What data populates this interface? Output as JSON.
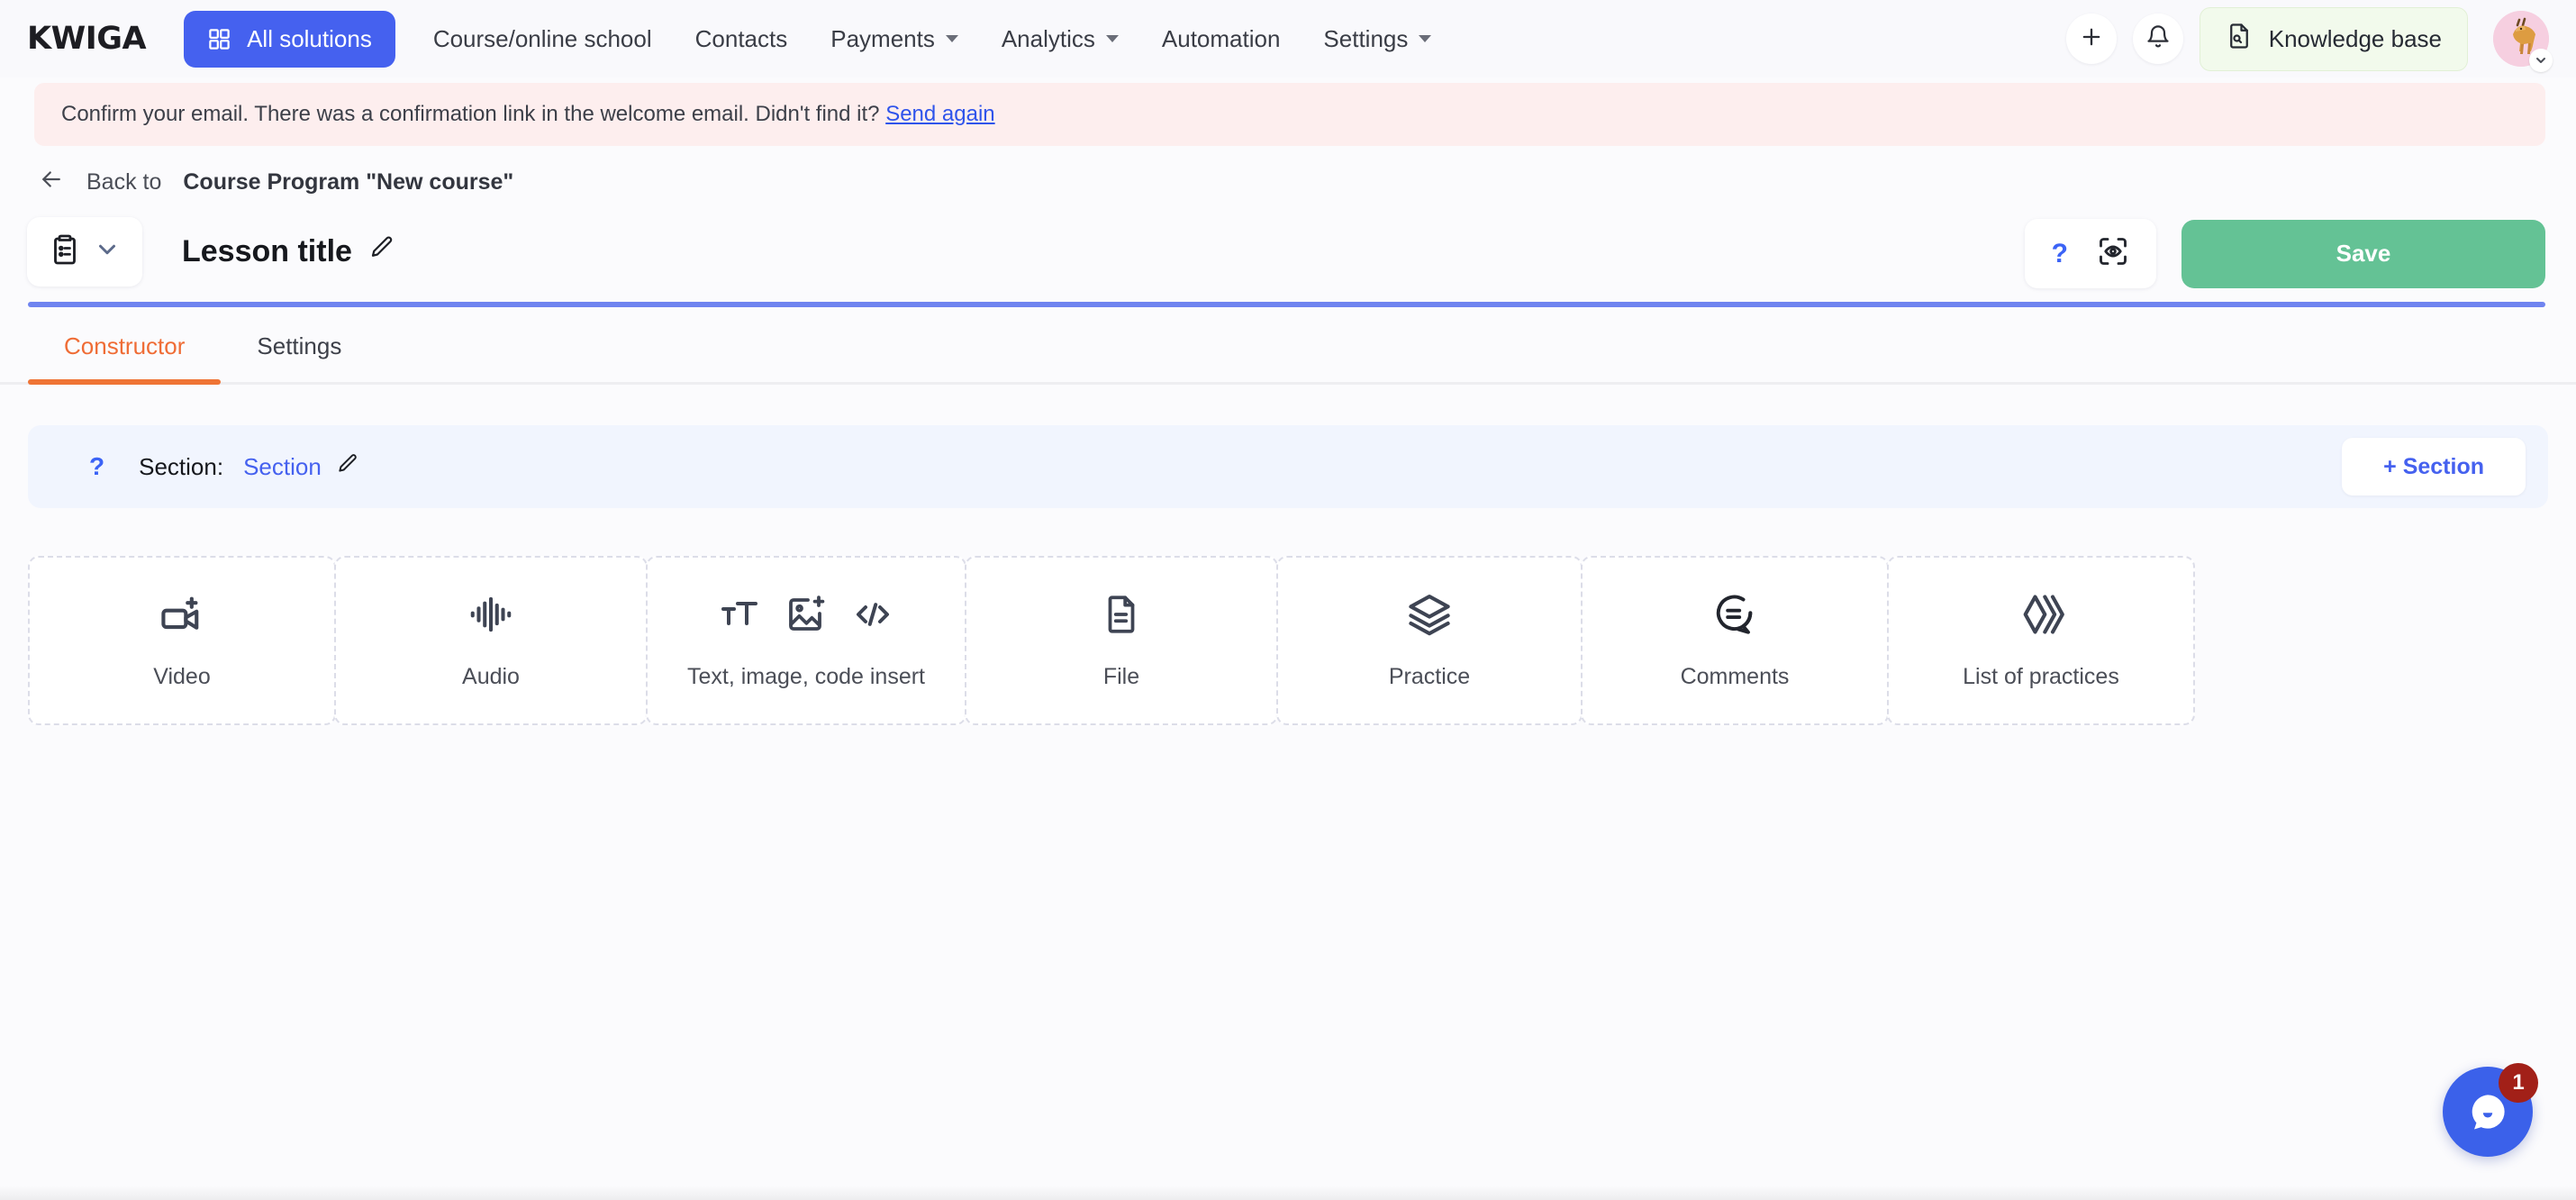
{
  "navbar": {
    "brand": "KWIGA",
    "all_solutions": {
      "label": "All solutions",
      "icon": "grid-icon",
      "bg": "#4561ef"
    },
    "links": [
      {
        "label": "Course/online school",
        "has_caret": false
      },
      {
        "label": "Contacts",
        "has_caret": false
      },
      {
        "label": "Payments",
        "has_caret": true
      },
      {
        "label": "Analytics",
        "has_caret": true
      },
      {
        "label": "Automation",
        "has_caret": false
      },
      {
        "label": "Settings",
        "has_caret": true
      }
    ],
    "add_icon": "plus-icon",
    "bell_icon": "bell-icon",
    "knowledge_base": {
      "label": "Knowledge base",
      "icon": "document-search-icon",
      "bg": "#f2faec"
    },
    "avatar": {
      "icon": "gazelle-avatar",
      "bg": "#f6cfe0"
    },
    "avatar_caret": "chevron-down-icon"
  },
  "alert": {
    "text": "Confirm your email. There was a confirmation link in the welcome email. Didn't find it?",
    "link_label": "Send again",
    "bg": "#fdeeee",
    "link_color": "#2f54eb"
  },
  "back_row": {
    "icon": "arrow-left-icon",
    "prefix": "Back to",
    "target": "Course Program \"New course\""
  },
  "title_row": {
    "type_icon": "clipboard-list-icon",
    "type_caret": "chevron-down-icon",
    "lesson_title": "Lesson title",
    "edit_icon": "pencil-icon",
    "help_label": "?",
    "preview_icon": "preview-eye-icon",
    "save_label": "Save",
    "save_color": "#64c295"
  },
  "progress": {
    "color": "#6f84f0",
    "percent": 100
  },
  "tabs": [
    {
      "label": "Constructor",
      "active": true
    },
    {
      "label": "Settings",
      "active": false
    }
  ],
  "tab_accent": "#ef7435",
  "section_bar": {
    "help": "?",
    "label": "Section:",
    "value": "Section",
    "edit_icon": "pencil-icon",
    "add_label": "+ Section",
    "bg": "#f1f5fe",
    "accent": "#4561ef"
  },
  "blocks": [
    {
      "label": "Video",
      "icons": [
        "video-camera-plus-icon"
      ],
      "width_class": "w-video"
    },
    {
      "label": "Audio",
      "icons": [
        "audio-waveform-icon"
      ],
      "width_class": "w-audio"
    },
    {
      "label": "Text, image, code insert",
      "icons": [
        "text-size-icon",
        "image-plus-icon",
        "code-brackets-icon"
      ],
      "width_class": "w-text"
    },
    {
      "label": "File",
      "icons": [
        "file-lines-icon"
      ],
      "width_class": "w-file"
    },
    {
      "label": "Practice",
      "icons": [
        "layers-icon"
      ],
      "width_class": "w-prac"
    },
    {
      "label": "Comments",
      "icons": [
        "comment-lines-icon"
      ],
      "width_class": "w-comm"
    },
    {
      "label": "List of practices",
      "icons": [
        "chevrons-diamond-icon"
      ],
      "width_class": "w-list"
    }
  ],
  "chat": {
    "icon": "chat-bubble-icon",
    "badge": "1",
    "bg": "#3b61ea",
    "badge_bg": "#a22018"
  }
}
